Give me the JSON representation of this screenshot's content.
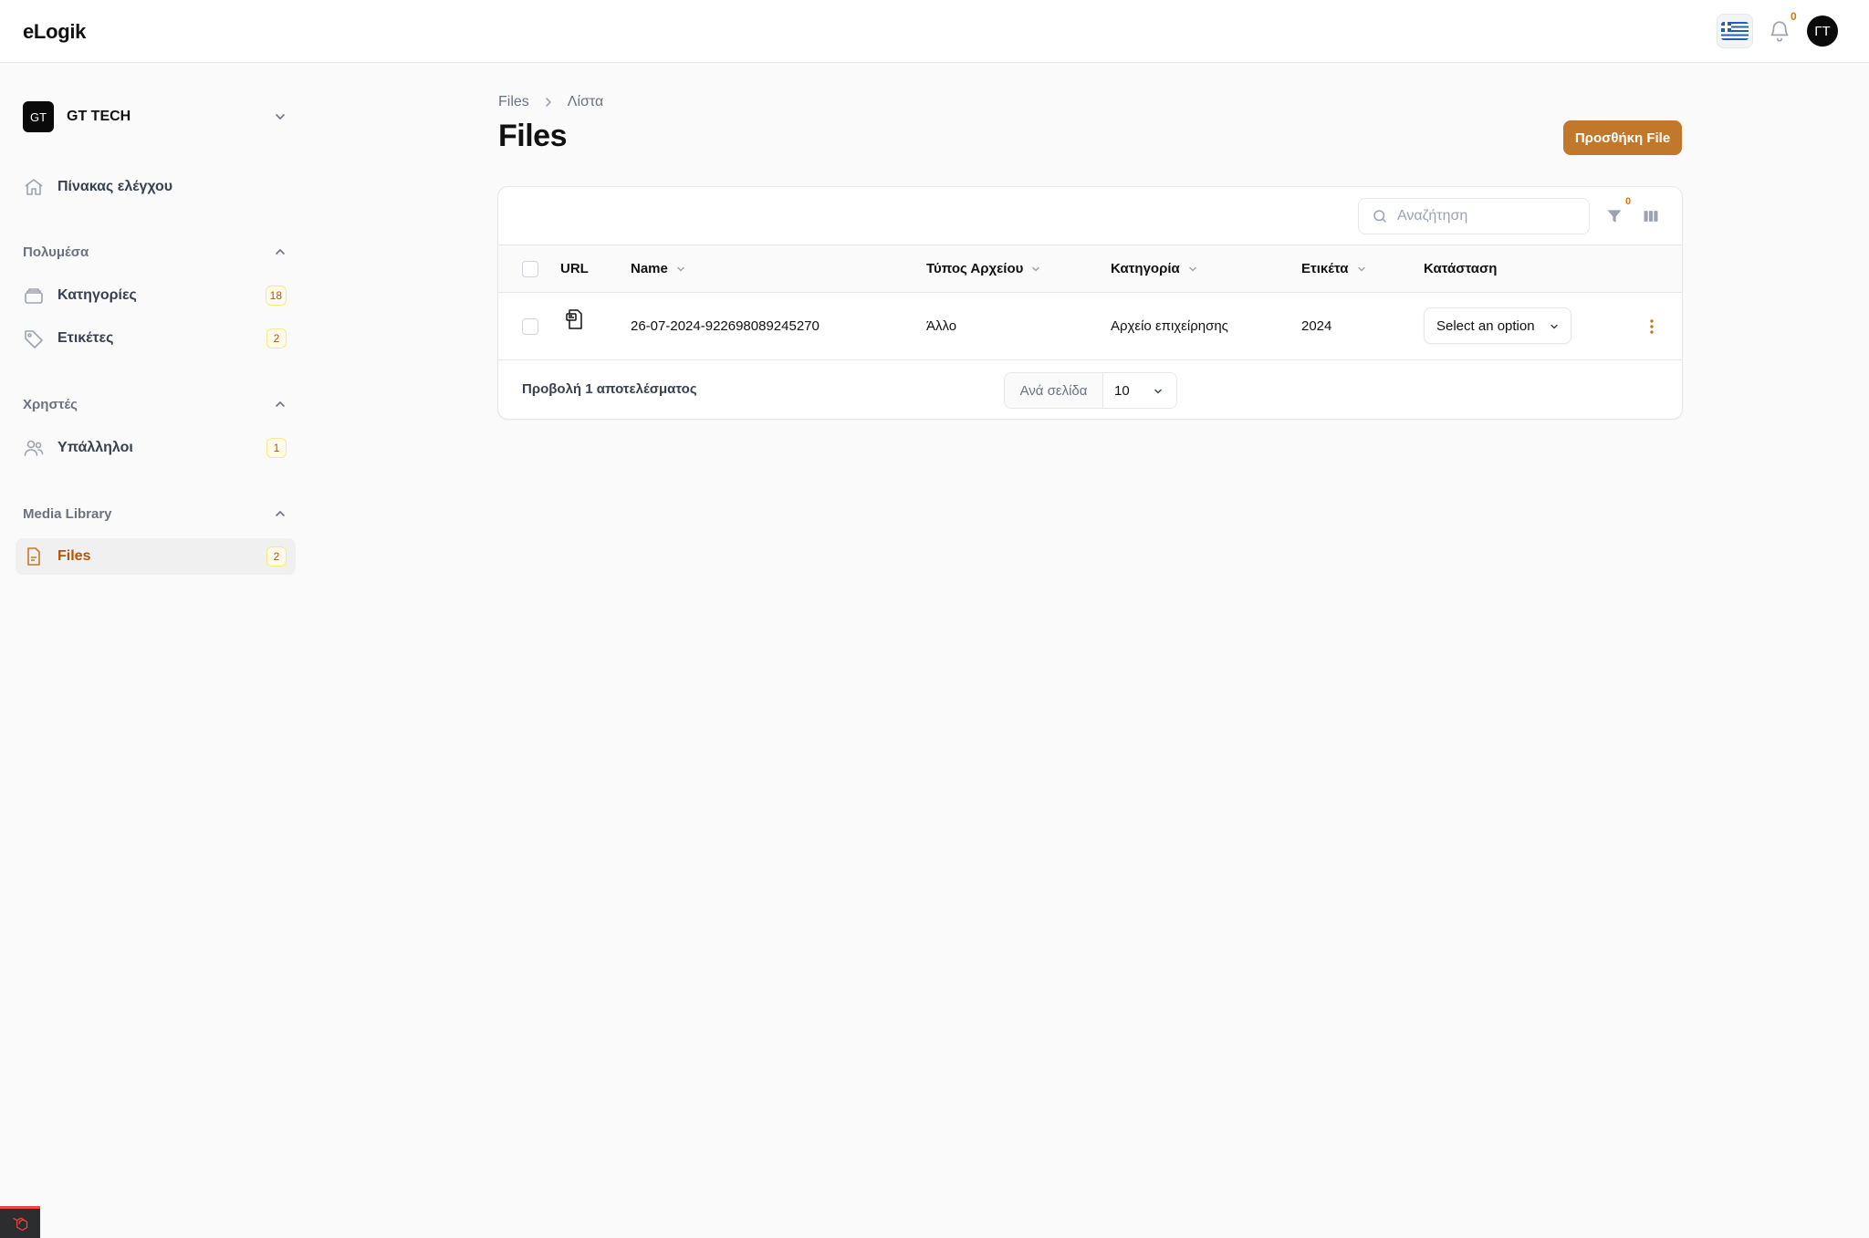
{
  "app": {
    "brand": "eLogik"
  },
  "topbar": {
    "notifications_count": "0",
    "user_initials": "ΓΤ",
    "language_icon": "greek-flag-icon"
  },
  "sidebar": {
    "tenant": {
      "logo_text": "GT",
      "name": "GT TECH"
    },
    "dashboard": {
      "label": "Πίνακας ελέγχου"
    },
    "groups": [
      {
        "label": "Πολυμέσα",
        "items": [
          {
            "label": "Κατηγορίες",
            "badge": "18"
          },
          {
            "label": "Ετικέτες",
            "badge": "2"
          }
        ]
      },
      {
        "label": "Χρηστές",
        "items": [
          {
            "label": "Υπάλληλοι",
            "badge": "1"
          }
        ]
      },
      {
        "label": "Media Library",
        "items": [
          {
            "label": "Files",
            "badge": "2",
            "active": true
          }
        ]
      }
    ]
  },
  "breadcrumb": {
    "root": "Files",
    "current": "Λίστα"
  },
  "page": {
    "title": "Files",
    "primary_action": "Προσθήκη File"
  },
  "table": {
    "search_placeholder": "Αναζήτηση",
    "filter_count": "0",
    "columns": {
      "url": "URL",
      "name": "Name",
      "type": "Τύπος Αρχείου",
      "category": "Κατηγορία",
      "tag": "Ετικέτα",
      "status": "Κατάσταση"
    },
    "rows": [
      {
        "name": "26-07-2024-922698089245270",
        "type": "Άλλο",
        "category": "Αρχείο επιχείρησης",
        "tag": "2024",
        "status": "Select an option"
      }
    ],
    "results_text": "Προβολή 1 αποτελέσματος",
    "per_page_label": "Ανά σελίδα",
    "per_page_value": "10"
  },
  "colors": {
    "accent": "#c2782a",
    "accent_text": "#b45309",
    "badge_bg": "#fffbeb"
  }
}
